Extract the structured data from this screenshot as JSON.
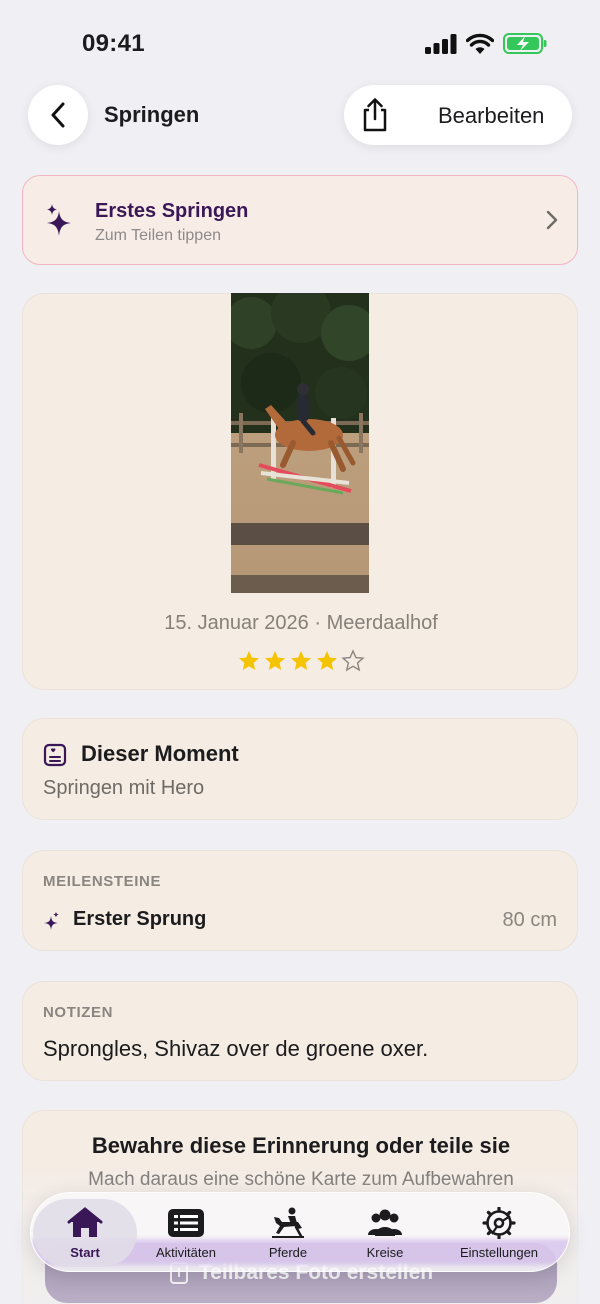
{
  "status_bar": {
    "time": "09:41"
  },
  "nav": {
    "title": "Springen",
    "edit_label": "Bearbeiten"
  },
  "banner": {
    "title": "Erstes Springen",
    "subtitle": "Zum Teilen tippen"
  },
  "photo_card": {
    "date": "15. Januar 2026",
    "separator": "·",
    "location": "Meerdaalhof",
    "rating": 4,
    "rating_max": 5,
    "star_color": "#f5c400"
  },
  "moment": {
    "title": "Dieser Moment",
    "text": "Springen mit Hero"
  },
  "milestones": {
    "label": "MEILENSTEINE",
    "items": [
      {
        "name": "Erster Sprung",
        "value": "80 cm"
      }
    ]
  },
  "notes": {
    "label": "NOTIZEN",
    "text": "Sprongles, Shivaz over de groene oxer."
  },
  "keep": {
    "title": "Bewahre diese Erinnerung oder teile sie",
    "subtitle": "Mach daraus eine schöne Karte zum Aufbewahren",
    "button_label": "Teilbares Foto erstellen"
  },
  "tabs": [
    {
      "label": "Start",
      "icon": "home-icon",
      "active": true
    },
    {
      "label": "Aktivitäten",
      "icon": "list-icon",
      "active": false
    },
    {
      "label": "Pferde",
      "icon": "horse-rider-icon",
      "active": false
    },
    {
      "label": "Kreise",
      "icon": "people-icon",
      "active": false
    },
    {
      "label": "Einstellungen",
      "icon": "gear-icon",
      "active": false
    }
  ],
  "colors": {
    "accent": "#3a1857",
    "background": "#efeff4",
    "card": "#f5ece3",
    "banner_border": "#f2b6c4"
  }
}
